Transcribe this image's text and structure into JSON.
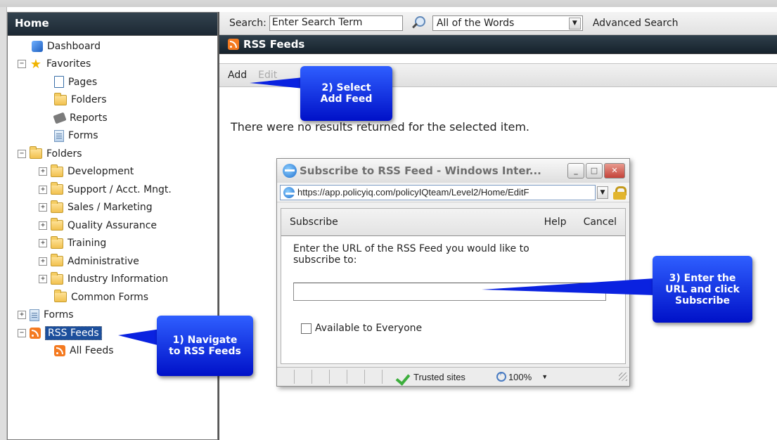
{
  "sidebar": {
    "header": "Home",
    "items": [
      {
        "label": "Dashboard",
        "icon": "dashboard-icon"
      },
      {
        "label": "Favorites",
        "icon": "star-icon"
      },
      {
        "label": "Pages",
        "icon": "page-icon"
      },
      {
        "label": "Folders",
        "icon": "folder-icon"
      },
      {
        "label": "Reports",
        "icon": "report-icon"
      },
      {
        "label": "Forms",
        "icon": "form-icon"
      },
      {
        "label": "Folders",
        "icon": "folder-icon"
      },
      {
        "label": "Development",
        "icon": "folder-icon"
      },
      {
        "label": "Support / Acct. Mngt.",
        "icon": "folder-icon"
      },
      {
        "label": "Sales / Marketing",
        "icon": "folder-icon"
      },
      {
        "label": "Quality Assurance",
        "icon": "folder-icon"
      },
      {
        "label": "Training",
        "icon": "folder-icon"
      },
      {
        "label": "Administrative",
        "icon": "folder-icon"
      },
      {
        "label": "Industry Information",
        "icon": "folder-icon"
      },
      {
        "label": "Common Forms",
        "icon": "folder-icon"
      },
      {
        "label": "Forms",
        "icon": "form-icon"
      },
      {
        "label": "RSS Feeds",
        "icon": "rss-icon"
      },
      {
        "label": "All Feeds",
        "icon": "rss-icon"
      }
    ]
  },
  "search": {
    "label": "Search:",
    "value": "Enter Search Term",
    "scope": "All of the Words",
    "advanced": "Advanced Search"
  },
  "page": {
    "title": "RSS Feeds",
    "toolbar_add": "Add",
    "toolbar_edit": "Edit",
    "empty_message": "There were no results returned for the selected item."
  },
  "dialog": {
    "title": "Subscribe to RSS Feed - Windows Inter...",
    "address": "https://app.policyiq.com/policyIQteam/Level2/Home/EditF",
    "subscribe": "Subscribe",
    "help": "Help",
    "cancel": "Cancel",
    "prompt": "Enter the URL of the RSS Feed you would like to subscribe to:",
    "url_value": "",
    "checkbox_label": "Available to Everyone",
    "zone": "Trusted sites",
    "zoom": "100%"
  },
  "callouts": {
    "step1": "1) Navigate to RSS Feeds",
    "step2": "2) Select Add Feed",
    "step3": "3) Enter the URL and click Subscribe"
  },
  "colors": {
    "callout_blue": "#0a22e0",
    "header_dark": "#1c2833",
    "selection_blue": "#1c4f9c",
    "rss_orange": "#f47a20"
  }
}
